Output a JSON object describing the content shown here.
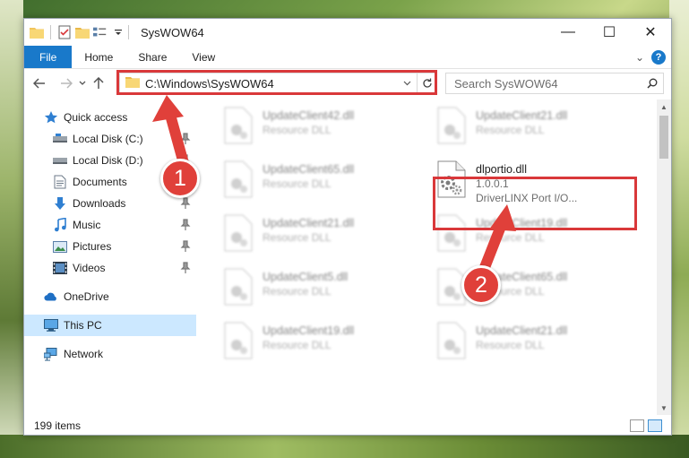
{
  "window": {
    "title": "SysWOW64",
    "minimize": "—",
    "maximize": "☐",
    "close": "✕"
  },
  "ribbon": {
    "tabs": [
      "File",
      "Home",
      "Share",
      "View"
    ],
    "collapse": "⌄",
    "help": "?"
  },
  "address": {
    "path": "C:\\Windows\\SysWOW64",
    "search_placeholder": "Search SysWOW64"
  },
  "nav": {
    "quick_access": "Quick access",
    "items": [
      "Local Disk (C:)",
      "Local Disk (D:)",
      "Documents",
      "Downloads",
      "Music",
      "Pictures",
      "Videos"
    ],
    "onedrive": "OneDrive",
    "this_pc": "This PC",
    "network": "Network"
  },
  "files": [
    {
      "name": "UpdateClient42.dll",
      "sub": "Resource DLL"
    },
    {
      "name": "UpdateClient21.dll",
      "sub": "Resource DLL"
    },
    {
      "name": "UpdateClient65.dll",
      "sub": "Resource DLL"
    },
    {
      "name": "dlportio.dll",
      "version": "1.0.0.1",
      "desc": "DriverLINX Port I/O..."
    },
    {
      "name": "UpdateClient21.dll",
      "sub": "Resource DLL"
    },
    {
      "name": "UpdateClient19.dll",
      "sub": "Resource DLL"
    },
    {
      "name": "UpdateClient5.dll",
      "sub": "Resource DLL"
    },
    {
      "name": "UpdateClient65.dll",
      "sub": "Resource DLL"
    },
    {
      "name": "UpdateClient19.dll",
      "sub": "Resource DLL"
    },
    {
      "name": "UpdateClient21.dll",
      "sub": "Resource DLL"
    }
  ],
  "status": {
    "items_count": "199 items"
  },
  "callouts": [
    "1",
    "2"
  ],
  "colors": {
    "accent": "#1979ca",
    "highlight": "#d9383a",
    "selected": "#cce8ff"
  }
}
